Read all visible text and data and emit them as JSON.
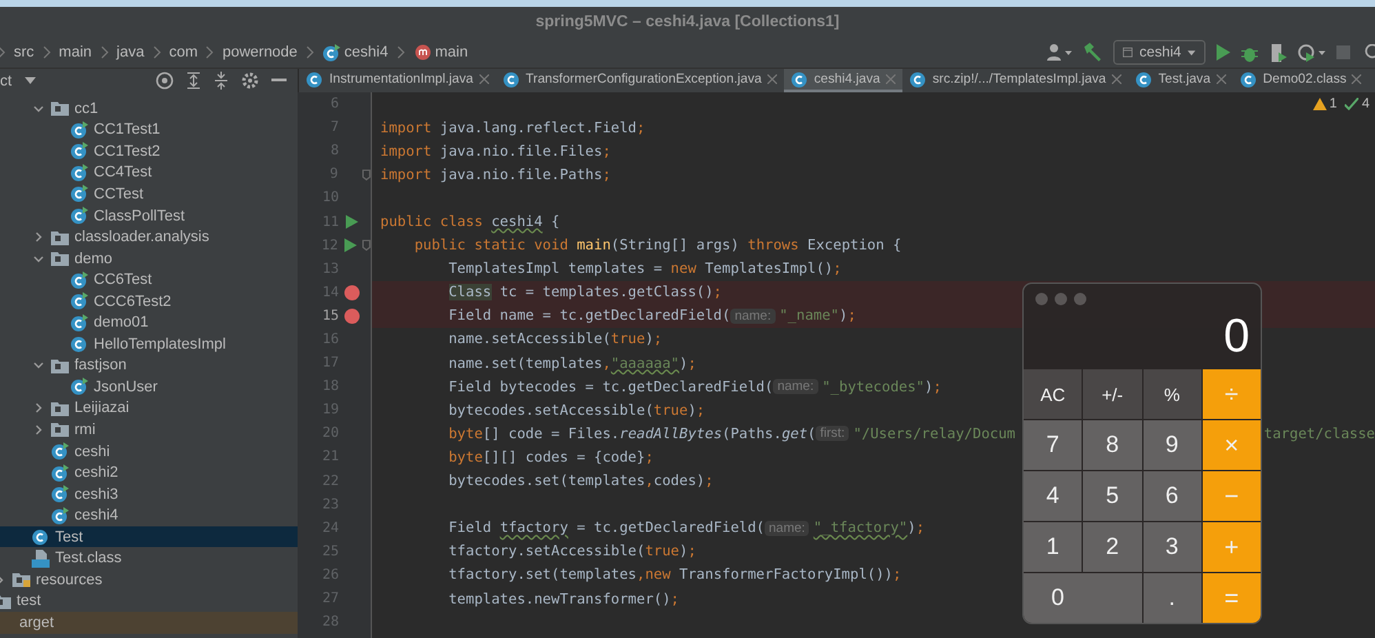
{
  "window": {
    "title": "spring5MVC – ceshi4.java [Collections1]"
  },
  "breadcrumb": [
    {
      "label": "src",
      "kind": "folder"
    },
    {
      "label": "main",
      "kind": "folder"
    },
    {
      "label": "java",
      "kind": "folder"
    },
    {
      "label": "com",
      "kind": "folder"
    },
    {
      "label": "powernode",
      "kind": "folder"
    },
    {
      "label": "ceshi4",
      "kind": "class"
    },
    {
      "label": "main",
      "kind": "method"
    }
  ],
  "toolbar": {
    "run_config": "ceshi4"
  },
  "project_panel": {
    "title": "ct",
    "tree": [
      {
        "children": [
          {
            "children": [
              {
                "children": [
                  {
                    "children": [
                      {
                        "label": "cc1",
                        "kind": "folder",
                        "expanded": true,
                        "selected": false,
                        "children": [
                          {
                            "label": "CC1Test1",
                            "kind": "class",
                            "runnable": true,
                            "selected": false
                          },
                          {
                            "label": "CC1Test2",
                            "kind": "class",
                            "runnable": true,
                            "selected": false
                          },
                          {
                            "label": "CC4Test",
                            "kind": "class",
                            "runnable": true,
                            "selected": false
                          },
                          {
                            "label": "CCTest",
                            "kind": "class",
                            "runnable": true,
                            "selected": false
                          },
                          {
                            "label": "ClassPollTest",
                            "kind": "class",
                            "runnable": true,
                            "selected": false
                          }
                        ]
                      },
                      {
                        "label": "classloader.analysis",
                        "kind": "folder",
                        "expanded": false,
                        "selected": false
                      },
                      {
                        "label": "demo",
                        "kind": "folder",
                        "expanded": true,
                        "selected": false,
                        "children": [
                          {
                            "label": "CC6Test",
                            "kind": "class",
                            "runnable": true,
                            "selected": false
                          },
                          {
                            "label": "CCC6Test2",
                            "kind": "class",
                            "runnable": true,
                            "selected": false
                          },
                          {
                            "label": "demo01",
                            "kind": "class",
                            "runnable": true,
                            "selected": false
                          },
                          {
                            "label": "HelloTemplatesImpl",
                            "kind": "class",
                            "runnable": false,
                            "selected": false
                          }
                        ]
                      },
                      {
                        "label": "fastjson",
                        "kind": "folder",
                        "expanded": true,
                        "selected": false,
                        "children": [
                          {
                            "label": "JsonUser",
                            "kind": "class",
                            "runnable": true,
                            "selected": false
                          }
                        ]
                      },
                      {
                        "label": "Leijiazai",
                        "kind": "folder",
                        "expanded": false,
                        "selected": false
                      },
                      {
                        "label": "rmi",
                        "kind": "folder",
                        "expanded": false,
                        "selected": false
                      },
                      {
                        "label": "ceshi",
                        "kind": "class",
                        "runnable": true,
                        "selected": false
                      },
                      {
                        "label": "ceshi2",
                        "kind": "class",
                        "runnable": true,
                        "selected": false
                      },
                      {
                        "label": "ceshi3",
                        "kind": "class",
                        "runnable": true,
                        "selected": false
                      },
                      {
                        "label": "ceshi4",
                        "kind": "class",
                        "runnable": true,
                        "selected": false
                      }
                    ]
                  },
                  {
                    "label": "Test",
                    "kind": "class",
                    "runnable": false,
                    "selected": true
                  },
                  {
                    "label": "Test.class",
                    "kind": "classfile",
                    "selected": false
                  }
                ]
              },
              {
                "label": "resources",
                "kind": "resources",
                "expanded": false,
                "selected": false
              }
            ]
          },
          {
            "label": "test",
            "kind": "folder",
            "selected": false
          }
        ]
      },
      {
        "label": "arget",
        "kind": "excluded",
        "selected": false
      }
    ]
  },
  "tabs": [
    {
      "label": "InstrumentationImpl.java",
      "selected": false
    },
    {
      "label": "TransformerConfigurationException.java",
      "selected": false
    },
    {
      "label": "ceshi4.java",
      "selected": true
    },
    {
      "label": "src.zip!/.../TemplatesImpl.java",
      "selected": false
    },
    {
      "label": "Test.java",
      "selected": false
    },
    {
      "label": "Demo02.class",
      "selected": false
    }
  ],
  "inspections": {
    "warnings": "1",
    "checks": "4"
  },
  "editor": {
    "lines": [
      {
        "number": "6",
        "current": false,
        "fold": false,
        "run": false,
        "breakpoint": false
      },
      {
        "number": "7",
        "current": false,
        "fold": false,
        "run": false,
        "breakpoint": false,
        "tokens": [
          {
            "kind": "kw",
            "text": "import"
          },
          {
            "kind": "pl",
            "text": " java.lang.reflect.Field"
          },
          {
            "kind": "kw",
            "text": ";"
          }
        ]
      },
      {
        "number": "8",
        "current": false,
        "fold": false,
        "run": false,
        "breakpoint": false,
        "tokens": [
          {
            "kind": "kw",
            "text": "import"
          },
          {
            "kind": "pl",
            "text": " java.nio.file.Files"
          },
          {
            "kind": "kw",
            "text": ";"
          }
        ]
      },
      {
        "number": "9",
        "current": false,
        "fold": true,
        "run": false,
        "breakpoint": false,
        "tokens": [
          {
            "kind": "kw",
            "text": "import"
          },
          {
            "kind": "pl",
            "text": " java.nio.file.Paths"
          },
          {
            "kind": "kw",
            "text": ";"
          }
        ]
      },
      {
        "number": "10",
        "current": false,
        "fold": false,
        "run": false,
        "breakpoint": false
      },
      {
        "number": "11",
        "current": false,
        "fold": false,
        "run": true,
        "breakpoint": false,
        "tokens": [
          {
            "kind": "kw",
            "text": "public class "
          },
          {
            "kind": "wavy",
            "text": "ceshi4"
          },
          {
            "kind": "pl",
            "text": " {"
          }
        ]
      },
      {
        "number": "12",
        "current": false,
        "fold": true,
        "run": true,
        "breakpoint": false,
        "tokens": [
          {
            "kind": "kw",
            "text": "    public static void "
          },
          {
            "kind": "fn",
            "text": "main"
          },
          {
            "kind": "pl",
            "text": "(String[] args) "
          },
          {
            "kind": "kw",
            "text": "throws"
          },
          {
            "kind": "pl",
            "text": " Exception {"
          }
        ]
      },
      {
        "number": "13",
        "current": false,
        "fold": false,
        "run": false,
        "breakpoint": false,
        "tokens": [
          {
            "kind": "pl",
            "text": "        TemplatesImpl templates = "
          },
          {
            "kind": "kw",
            "text": "new"
          },
          {
            "kind": "pl",
            "text": " TemplatesImpl()"
          },
          {
            "kind": "kw",
            "text": ";"
          }
        ]
      },
      {
        "number": "14",
        "current": false,
        "fold": false,
        "run": false,
        "breakpoint": true,
        "tokens": [
          {
            "kind": "hl",
            "text": "        Class"
          },
          {
            "kind": "pl",
            "text": " tc = templates.getClass()"
          },
          {
            "kind": "kw",
            "text": ";"
          }
        ]
      },
      {
        "number": "15",
        "current": true,
        "fold": false,
        "run": false,
        "breakpoint": true,
        "tokens": [
          {
            "kind": "pl",
            "text": "        Field name = tc.getDeclaredField("
          },
          {
            "kind": "hint",
            "text": "name:"
          },
          {
            "kind": "str",
            "text": "\"_name\""
          },
          {
            "kind": "pl",
            "text": ")"
          },
          {
            "kind": "kw",
            "text": ";"
          }
        ]
      },
      {
        "number": "16",
        "current": false,
        "fold": false,
        "run": false,
        "breakpoint": false,
        "tokens": [
          {
            "kind": "pl",
            "text": "        name.setAccessible("
          },
          {
            "kind": "kw",
            "text": "true"
          },
          {
            "kind": "pl",
            "text": ")"
          },
          {
            "kind": "kw",
            "text": ";"
          }
        ]
      },
      {
        "number": "17",
        "current": false,
        "fold": false,
        "run": false,
        "breakpoint": false,
        "tokens": [
          {
            "kind": "pl",
            "text": "        name.set(templates"
          },
          {
            "kind": "kw",
            "text": ","
          },
          {
            "kind": "strw",
            "text": "\"aaaaaa\""
          },
          {
            "kind": "pl",
            "text": ")"
          },
          {
            "kind": "kw",
            "text": ";"
          }
        ]
      },
      {
        "number": "18",
        "current": false,
        "fold": false,
        "run": false,
        "breakpoint": false,
        "tokens": [
          {
            "kind": "pl",
            "text": "        Field bytecodes = tc.getDeclaredField("
          },
          {
            "kind": "hint",
            "text": "name:"
          },
          {
            "kind": "str",
            "text": "\"_bytecodes\""
          },
          {
            "kind": "pl",
            "text": ")"
          },
          {
            "kind": "kw",
            "text": ";"
          }
        ]
      },
      {
        "number": "19",
        "current": false,
        "fold": false,
        "run": false,
        "breakpoint": false,
        "tokens": [
          {
            "kind": "pl",
            "text": "        bytecodes.setAccessible("
          },
          {
            "kind": "kw",
            "text": "true"
          },
          {
            "kind": "pl",
            "text": ")"
          },
          {
            "kind": "kw",
            "text": ";"
          }
        ]
      },
      {
        "number": "20",
        "current": false,
        "fold": false,
        "run": false,
        "breakpoint": false,
        "tokens": [
          {
            "kind": "kw",
            "text": "        byte"
          },
          {
            "kind": "pl",
            "text": "[] code = Files."
          },
          {
            "kind": "it",
            "text": "readAllBytes"
          },
          {
            "kind": "pl",
            "text": "(Paths."
          },
          {
            "kind": "it",
            "text": "get"
          },
          {
            "kind": "pl",
            "text": "("
          },
          {
            "kind": "hint",
            "text": "first:"
          },
          {
            "kind": "str",
            "text": "\"/Users/relay/Docum"
          }
        ],
        "tail": "target/classe"
      },
      {
        "number": "21",
        "current": false,
        "fold": false,
        "run": false,
        "breakpoint": false,
        "tokens": [
          {
            "kind": "kw",
            "text": "        byte"
          },
          {
            "kind": "pl",
            "text": "[][] codes = {code}"
          },
          {
            "kind": "kw",
            "text": ";"
          }
        ]
      },
      {
        "number": "22",
        "current": false,
        "fold": false,
        "run": false,
        "breakpoint": false,
        "tokens": [
          {
            "kind": "pl",
            "text": "        bytecodes.set(templates"
          },
          {
            "kind": "kw",
            "text": ","
          },
          {
            "kind": "pl",
            "text": "codes)"
          },
          {
            "kind": "kw",
            "text": ";"
          }
        ]
      },
      {
        "number": "23",
        "current": false,
        "fold": false,
        "run": false,
        "breakpoint": false
      },
      {
        "number": "24",
        "current": false,
        "fold": false,
        "run": false,
        "breakpoint": false,
        "tokens": [
          {
            "kind": "pl",
            "text": "        Field "
          },
          {
            "kind": "wavy",
            "text": "tfactory"
          },
          {
            "kind": "pl",
            "text": " = tc.getDeclaredField("
          },
          {
            "kind": "hint",
            "text": "name:"
          },
          {
            "kind": "strw",
            "text": "\"_tfactory\""
          },
          {
            "kind": "pl",
            "text": ")"
          },
          {
            "kind": "kw",
            "text": ";"
          }
        ]
      },
      {
        "number": "25",
        "current": false,
        "fold": false,
        "run": false,
        "breakpoint": false,
        "tokens": [
          {
            "kind": "pl",
            "text": "        tfactory.setAccessible("
          },
          {
            "kind": "kw",
            "text": "true"
          },
          {
            "kind": "pl",
            "text": ")"
          },
          {
            "kind": "kw",
            "text": ";"
          }
        ]
      },
      {
        "number": "26",
        "current": false,
        "fold": false,
        "run": false,
        "breakpoint": false,
        "tokens": [
          {
            "kind": "pl",
            "text": "        tfactory.set(templates"
          },
          {
            "kind": "kw",
            "text": ",new"
          },
          {
            "kind": "pl",
            "text": " TransformerFactoryImpl())"
          },
          {
            "kind": "kw",
            "text": ";"
          }
        ]
      },
      {
        "number": "27",
        "current": false,
        "fold": false,
        "run": false,
        "breakpoint": false,
        "tokens": [
          {
            "kind": "pl",
            "text": "        templates.newTransformer()"
          },
          {
            "kind": "kw",
            "text": ";"
          }
        ]
      },
      {
        "number": "28",
        "current": false,
        "fold": false,
        "run": false,
        "breakpoint": false
      }
    ]
  },
  "calculator": {
    "display": "0",
    "keys": [
      {
        "label": "AC",
        "kind": "func"
      },
      {
        "label": "+/-",
        "kind": "func"
      },
      {
        "label": "%",
        "kind": "func"
      },
      {
        "label": "÷",
        "kind": "op"
      },
      {
        "label": "7",
        "kind": "num"
      },
      {
        "label": "8",
        "kind": "num"
      },
      {
        "label": "9",
        "kind": "num"
      },
      {
        "label": "×",
        "kind": "op"
      },
      {
        "label": "4",
        "kind": "num"
      },
      {
        "label": "5",
        "kind": "num"
      },
      {
        "label": "6",
        "kind": "num"
      },
      {
        "label": "−",
        "kind": "op"
      },
      {
        "label": "1",
        "kind": "num"
      },
      {
        "label": "2",
        "kind": "num"
      },
      {
        "label": "3",
        "kind": "num"
      },
      {
        "label": "+",
        "kind": "op"
      },
      {
        "label": "0",
        "kind": "wide"
      },
      {
        "label": ".",
        "kind": "num"
      },
      {
        "label": "=",
        "kind": "op"
      }
    ]
  }
}
